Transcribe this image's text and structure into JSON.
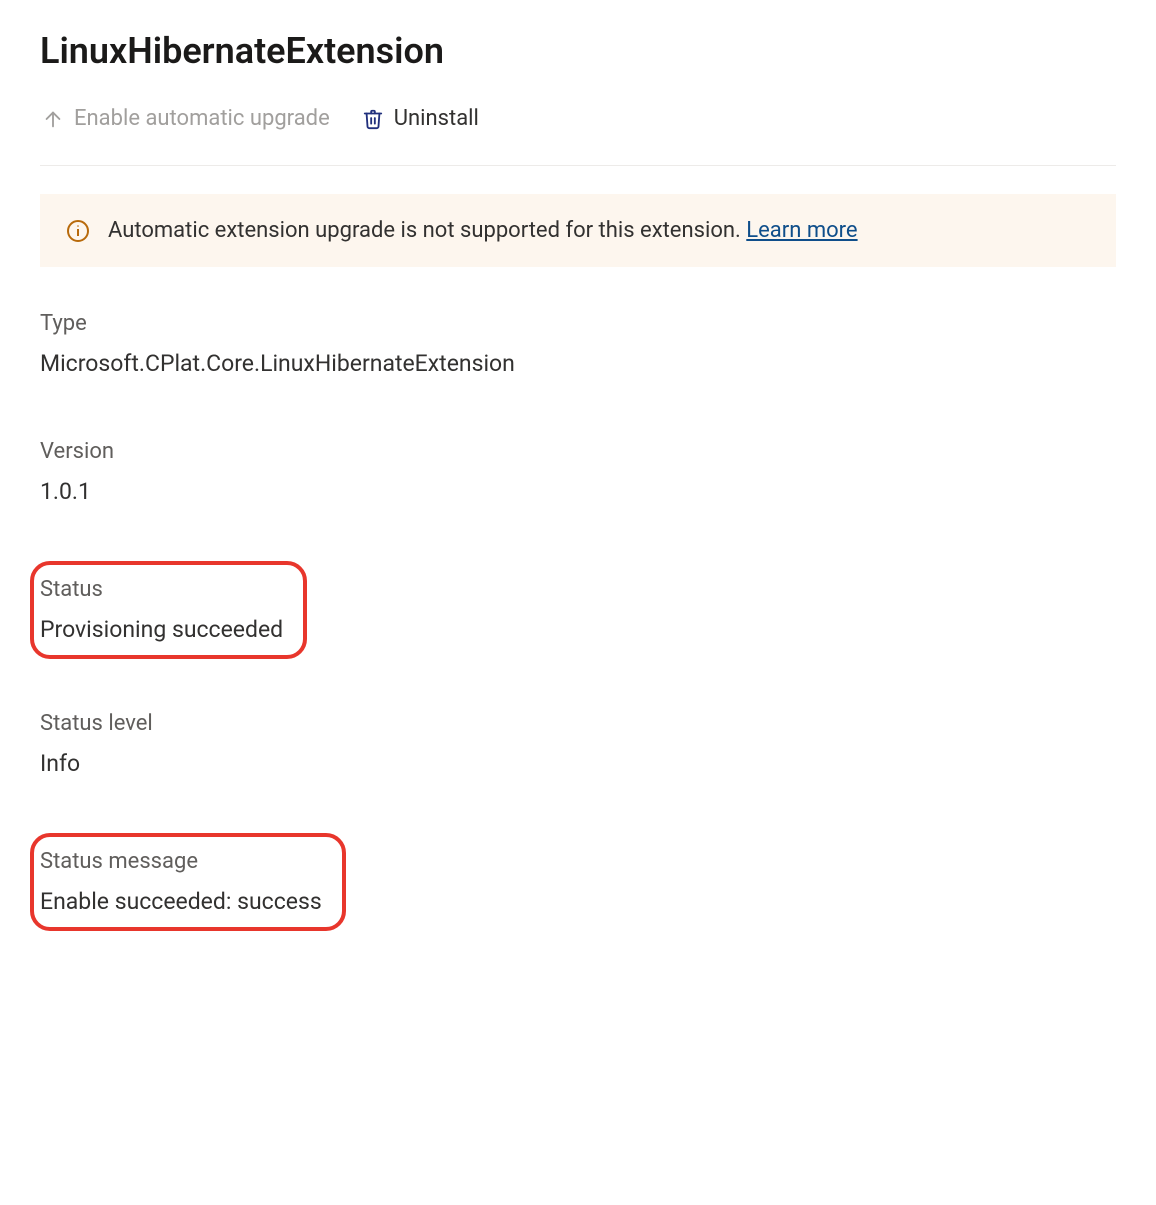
{
  "header": {
    "title": "LinuxHibernateExtension"
  },
  "toolbar": {
    "enable_auto_upgrade_label": "Enable automatic upgrade",
    "uninstall_label": "Uninstall"
  },
  "banner": {
    "message": "Automatic extension upgrade is not supported for this extension. ",
    "link_text": "Learn more"
  },
  "fields": {
    "type": {
      "label": "Type",
      "value": "Microsoft.CPlat.Core.LinuxHibernateExtension"
    },
    "version": {
      "label": "Version",
      "value": "1.0.1"
    },
    "status": {
      "label": "Status",
      "value": "Provisioning succeeded"
    },
    "status_level": {
      "label": "Status level",
      "value": "Info"
    },
    "status_message": {
      "label": "Status message",
      "value": "Enable succeeded: success"
    }
  }
}
